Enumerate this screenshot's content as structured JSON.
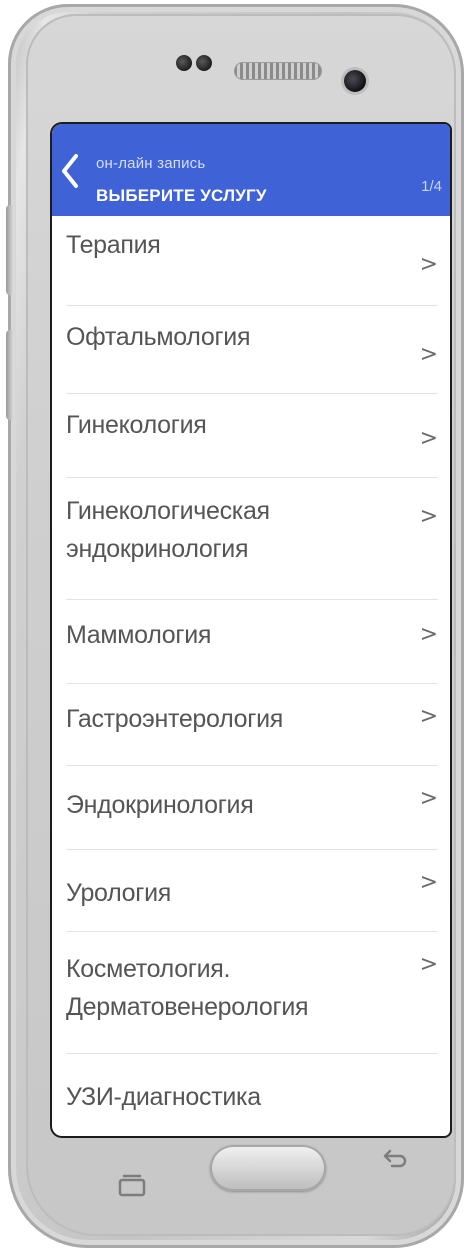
{
  "header": {
    "subtitle": "он-лайн запись",
    "title": "ВЫБЕРИТЕ УСЛУГУ",
    "step": "1/4",
    "accent_color": "#3f63d6"
  },
  "services": [
    {
      "label": "Терапия"
    },
    {
      "label": "Офтальмология"
    },
    {
      "label": "Гинекология"
    },
    {
      "label": "Гинекологическая\nэндокринология"
    },
    {
      "label": "Маммология"
    },
    {
      "label": "Гастроэнтерология"
    },
    {
      "label": "Эндокринология"
    },
    {
      "label": "Урология"
    },
    {
      "label": "Косметология.\nДерматовенерология"
    },
    {
      "label": "УЗИ-диагностика"
    }
  ],
  "arrow_glyph": ">",
  "icons": {
    "back": "chevron-left-icon",
    "recent_apps": "recent-apps-icon",
    "home": "home-button",
    "system_back": "system-back-icon"
  }
}
